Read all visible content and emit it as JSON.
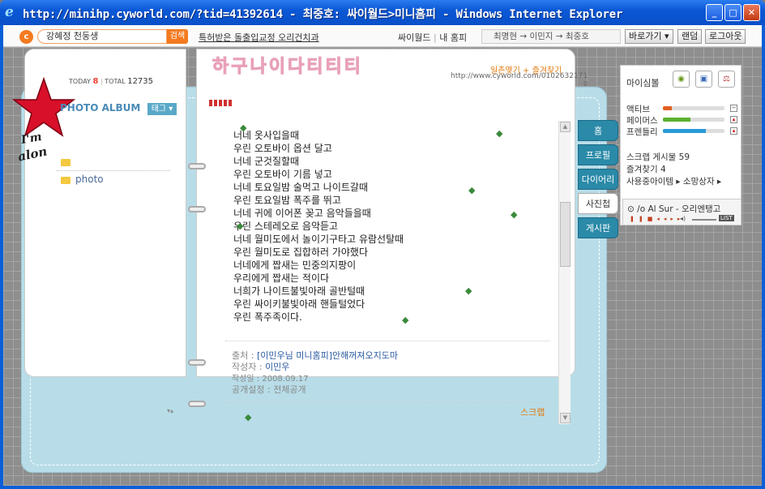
{
  "window": {
    "title": "http://minihp.cyworld.com/?tid=41392614 - 최중호: 싸이월드>미니홈피 - Windows Internet Explorer",
    "minimize": "_",
    "maximize": "□",
    "close": "✕"
  },
  "topbar": {
    "logo": "c",
    "search_value": "강혜정 천둥생",
    "search_button": "검색",
    "promo_link": "특허받은 돌출입교정 오리건치과",
    "nav_cyworld": "싸이월드",
    "nav_sep": "|",
    "nav_myhome": "내 홈피",
    "friend_path": "최명현 → 이민지 → 최중호",
    "goto_button": "바로가기 ▾",
    "random_button": "랜덤",
    "logout_button": "로그아웃"
  },
  "minihome": {
    "decor_title": "하구나이다티티티",
    "today_label": "TODAY",
    "today_count": "8",
    "total_label": "TOTAL",
    "total_count": "12735",
    "ilchon_link": "일촌맺기",
    "favorite_link": "즐겨찾기",
    "url": "http://www.cyworld.com/0102632171",
    "url_count": "0",
    "album_title": "PHOTO ALBUM",
    "tag_button": "태그 ▾",
    "folder_name": "photo",
    "star_text_1": "I'm",
    "star_text_2": "alon",
    "poem": [
      "너네 옷사입을때",
      "우린 오토바이 옵션 달고",
      "너네 군것질할때",
      "우린 오토바이 기름 넣고",
      "너네 토요일밤 술먹고 나이트갈때",
      "우린 토요일밤 폭주를 뛰고",
      "너네 귀에 이어폰 꽂고 음악들을때",
      "우린 스테레오로 음악듣고",
      "너네 월미도에서 놀이기구타고 유람선탈때",
      "우린 월미도로 집합하러 가야했다",
      "너네에게 짭새는 민중의지팡이",
      "우리에게 짭새는 적이다",
      "너희가 나이트불빛아래 골반털때",
      "우린 싸이키불빛아래 핸들털었다",
      "우린 폭주족이다."
    ],
    "source_label": "출처 :",
    "source_value": "[이민우님 미니홈피]안해꺼져오지도마",
    "author_label": "작성자 :",
    "author_value": "이민우",
    "date_label": "작성일 :",
    "date_value": "2008.09.17",
    "public_label": "공개설정 :",
    "public_value": "전체공개",
    "scrap_link": "스크랩",
    "tabs": [
      "홈",
      "프로필",
      "다이어리",
      "사진첩",
      "게시판"
    ]
  },
  "rightpanel": {
    "mood_label": "마이심볼",
    "stat_active": "액티브",
    "stat_famous": "페이머스",
    "stat_friendly": "프렌들리",
    "stat_active_level": 0.15,
    "stat_famous_level": 0.45,
    "stat_friendly_level": 0.7,
    "scrap_count": "스크랩 게시물 59",
    "favorites": "즐겨찾기 4",
    "items": "사용중아이템 ▸ 소망상자 ▸",
    "player_title": "/o Al Sur - 오리엔탱고",
    "player_list": "LIST"
  },
  "colors": {
    "accent_orange": "#f47a20",
    "book_blue": "#b8dde8",
    "tab_teal": "#2a8aa8"
  }
}
